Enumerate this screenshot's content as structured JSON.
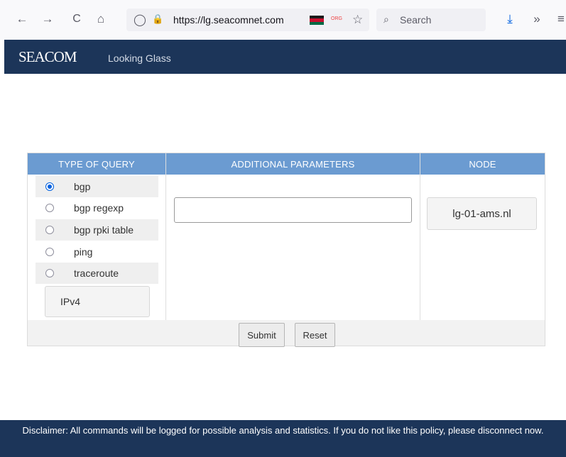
{
  "browser": {
    "url": "https://lg.seacomnet.com",
    "search_placeholder": "Search",
    "back_icon": "←",
    "forward_icon": "→",
    "reload_icon": "C",
    "home_icon": "⌂",
    "shield_icon": "◯",
    "lock_icon": "🔒",
    "star_icon": "☆",
    "download_icon": "⤓",
    "overflow_icon": "»",
    "menu_icon": "≡",
    "search_icon": "⌕",
    "ext_label": "ORG"
  },
  "header": {
    "logo": "SEACOM",
    "title": "Looking Glass",
    "bg_color": "#1c3559"
  },
  "form": {
    "columns": [
      "TYPE OF QUERY",
      "ADDITIONAL PARAMETERS",
      "NODE"
    ],
    "query_types": [
      {
        "label": "bgp",
        "selected": true
      },
      {
        "label": "bgp regexp",
        "selected": false
      },
      {
        "label": "bgp rpki table",
        "selected": false
      },
      {
        "label": "ping",
        "selected": false
      },
      {
        "label": "traceroute",
        "selected": false
      }
    ],
    "ip_version": "IPv4",
    "parameters_value": "",
    "node": "lg-01-ams.nl",
    "submit_label": "Submit",
    "reset_label": "Reset",
    "header_color": "#6b9bd1"
  },
  "footer": {
    "disclaimer": "Disclaimer: All commands will be logged for possible analysis and statistics. If you do not like this policy, please disconnect now."
  }
}
